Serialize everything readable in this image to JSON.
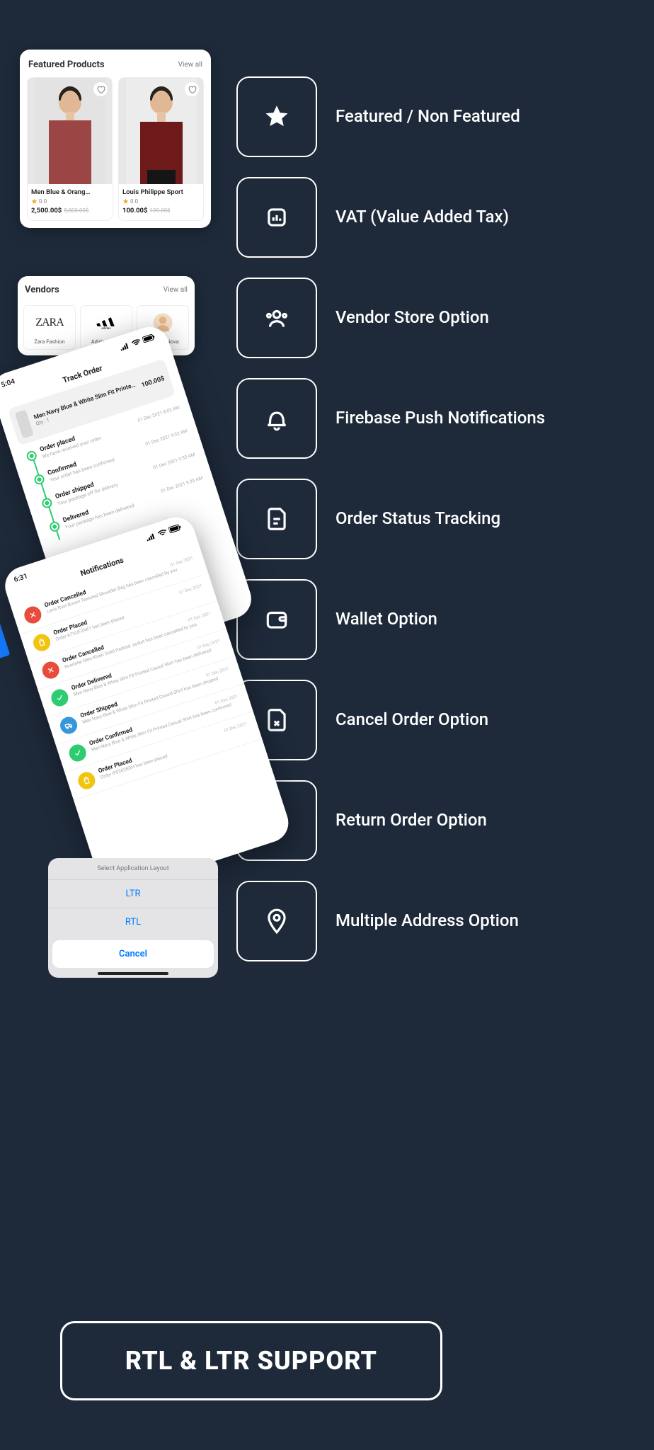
{
  "features": [
    {
      "icon": "star",
      "label": "Featured / Non Featured"
    },
    {
      "icon": "chart",
      "label": "VAT (Value Added Tax)"
    },
    {
      "icon": "people",
      "label": "Vendor Store Option"
    },
    {
      "icon": "bell",
      "label": "Firebase  Push Notifications"
    },
    {
      "icon": "file",
      "label": "Order Status Tracking"
    },
    {
      "icon": "wallet",
      "label": "Wallet Option"
    },
    {
      "icon": "file-x",
      "label": "Cancel Order Option"
    },
    {
      "icon": "file-dl",
      "label": "Return Order Option"
    },
    {
      "icon": "pin",
      "label": "Multiple Address Option"
    }
  ],
  "featured": {
    "title": "Featured Products",
    "view_all": "View all",
    "products": [
      {
        "name": "Men Blue & Orang…",
        "rating": "0.0",
        "price": "2,500.00$",
        "old_price": "5,000.00$"
      },
      {
        "name": "Louis Philippe Sport",
        "rating": "0.0",
        "price": "100.00$",
        "old_price": "120.00$"
      }
    ]
  },
  "vendors": {
    "title": "Vendors",
    "view_all": "View all",
    "items": [
      {
        "name": "Zara Fashion",
        "logo": "ZARA"
      },
      {
        "name": "Adidas Store",
        "logo": "adidas"
      },
      {
        "name": "Fashion Nova",
        "logo": "avatar"
      }
    ]
  },
  "track": {
    "time": "5:04",
    "title": "Track Order",
    "product": "Men Navy Blue & White Slim Fit Printe…",
    "qty": "Qty : 1",
    "price": "100.00$",
    "steps": [
      {
        "title": "Order placed",
        "sub": "We have received your order",
        "date": "01 Dec 2021 8:02 AM"
      },
      {
        "title": "Confirmed",
        "sub": "Your order has been confirmed",
        "date": "01 Dec 2021 9:32 AM"
      },
      {
        "title": "Order shipped",
        "sub": "Your package off for delivery",
        "date": "01 Dec 2021 9:33 AM"
      },
      {
        "title": "Delivered",
        "sub": "Your package has been delivered",
        "date": "01 Dec 2021 9:33 AM"
      }
    ]
  },
  "notif": {
    "time": "6:31",
    "title": "Notifications",
    "items": [
      {
        "color": "red",
        "icon": "x",
        "title": "Order Cancelled",
        "sub": "Levis Rust Brown Textured Shoulder Bag has been cancelled by you",
        "date": "01 Dec 2021"
      },
      {
        "color": "yellow",
        "icon": "bag",
        "title": "Order Placed",
        "sub": "Order K7VUF2AK1 has been placed",
        "date": "01 Dec 2021"
      },
      {
        "color": "red",
        "icon": "x",
        "title": "Order Cancelled",
        "sub": "Roadster Men Khaki Solid Padded Jacket has been cancelled by you",
        "date": "01 Dec 2021"
      },
      {
        "color": "green",
        "icon": "check",
        "title": "Order Delivered",
        "sub": "Men Navy Blue & White Slim Fit Printed Casual Shirt has been delivered",
        "date": "01 Dec 2021"
      },
      {
        "color": "blue",
        "icon": "truck",
        "title": "Order Shipped",
        "sub": "Men Navy Blue & White Slim Fit Printed Casual Shirt has been shipped",
        "date": "01 Dec 2021"
      },
      {
        "color": "green",
        "icon": "check",
        "title": "Order Confirmed",
        "sub": "Men Navy Blue & White Slim Fit Printed Casual Shirt has been confirmed",
        "date": "01 Dec 2021"
      },
      {
        "color": "yellow",
        "icon": "bag",
        "title": "Order Placed",
        "sub": "Order IF0282BDH has been placed",
        "date": "01 Dec 2021"
      }
    ]
  },
  "sheet": {
    "title": "Select Application Layout",
    "opts": [
      "LTR",
      "RTL"
    ],
    "cancel": "Cancel"
  },
  "banner": "RTL & LTR SUPPORT"
}
